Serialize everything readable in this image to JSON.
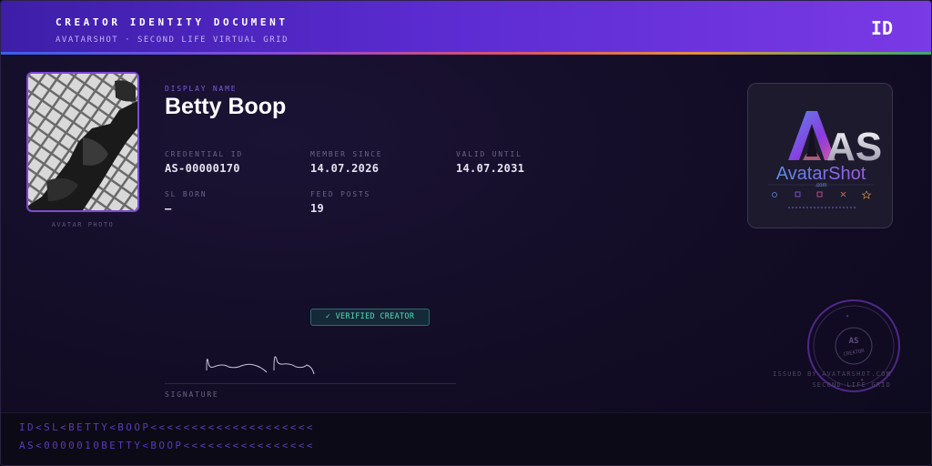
{
  "header": {
    "title": "CREATOR IDENTITY DOCUMENT",
    "subtitle": "AVATARSHOT · SECOND LIFE VIRTUAL GRID",
    "badge": "ID"
  },
  "photo": {
    "caption": "AVATAR PHOTO"
  },
  "identity": {
    "display_name_label": "DISPLAY NAME",
    "display_name": "Betty Boop"
  },
  "fields": {
    "credential_id_label": "CREDENTIAL ID",
    "credential_id": "AS-00000170",
    "member_since_label": "MEMBER SINCE",
    "member_since": "14.07.2026",
    "valid_until_label": "VALID UNTIL",
    "valid_until": "14.07.2031",
    "sl_born_label": "SL BORN",
    "sl_born": "—",
    "feed_posts_label": "FEED POSTS",
    "feed_posts": "19"
  },
  "logo": {
    "monogram": "AS",
    "brand": "AvatarShot",
    "domain": ".com"
  },
  "verified_badge": "✓ VERIFIED CREATOR",
  "signature": {
    "label": "SIGNATURE"
  },
  "seal": {
    "text": "AS",
    "sub": "CREATOR"
  },
  "issuer": {
    "line1": "ISSUED BY AVATARSHOT.COM",
    "line2": "SECOND LIFE GRID"
  },
  "mrz": {
    "line1": "ID<SL<BETTY<BOOP<<<<<<<<<<<<<<<<<<<<",
    "line2": "AS<0000010BETTY<BOOP<<<<<<<<<<<<<<<<"
  },
  "colors": {
    "header_start": "#3d1ea8",
    "header_end": "#7a3ae6",
    "accent": "#7d5ae0",
    "verified": "#58d8b8",
    "mrz": "#5a3ab8"
  }
}
